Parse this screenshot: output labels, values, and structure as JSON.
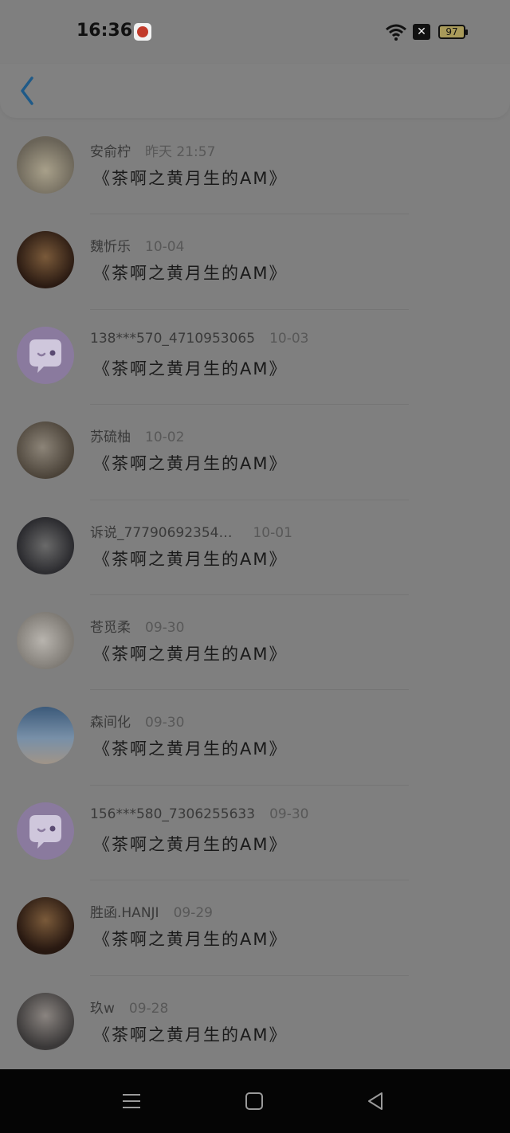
{
  "status_bar": {
    "time": "16:36",
    "battery": "97",
    "network_badge": "✕"
  },
  "header": {
    "back_icon": "chevron-left-icon"
  },
  "list": [
    {
      "name": "安俞柠",
      "time": "昨天 21:57",
      "message": "《茶啊之黄月生的AM》",
      "avatar": "photo"
    },
    {
      "name": "魏忻乐",
      "time": "10-04",
      "message": "《茶啊之黄月生的AM》",
      "avatar": "photo"
    },
    {
      "name": "138***570_4710953065",
      "time": "10-03",
      "message": "《茶啊之黄月生的AM》",
      "avatar": "default"
    },
    {
      "name": "苏硫柚",
      "time": "10-02",
      "message": "《茶啊之黄月生的AM》",
      "avatar": "photo"
    },
    {
      "name": "诉说_77790692354…",
      "time": "10-01",
      "message": "《茶啊之黄月生的AM》",
      "avatar": "photo"
    },
    {
      "name": "苍觅柔",
      "time": "09-30",
      "message": "《茶啊之黄月生的AM》",
      "avatar": "photo"
    },
    {
      "name": "森间化",
      "time": "09-30",
      "message": "《茶啊之黄月生的AM》",
      "avatar": "photo"
    },
    {
      "name": "156***580_7306255633",
      "time": "09-30",
      "message": "《茶啊之黄月生的AM》",
      "avatar": "default"
    },
    {
      "name": "胜函.HANJI",
      "time": "09-29",
      "message": "《茶啊之黄月生的AM》",
      "avatar": "photo"
    },
    {
      "name": "玖w",
      "time": "09-28",
      "message": "《茶啊之黄月生的AM》",
      "avatar": "photo"
    }
  ],
  "navbar": {
    "menu_icon": "menu-icon",
    "home_icon": "home-square-icon",
    "back_icon": "back-triangle-icon"
  }
}
